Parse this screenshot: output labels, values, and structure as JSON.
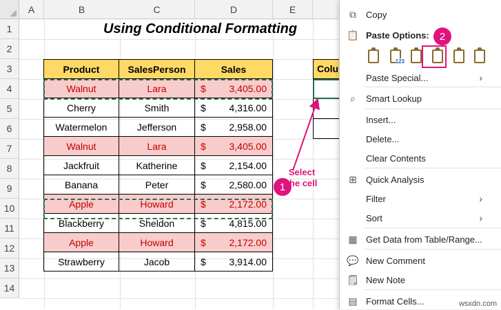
{
  "columns": [
    "A",
    "B",
    "C",
    "D",
    "E"
  ],
  "rows": [
    "1",
    "2",
    "3",
    "4",
    "5",
    "6",
    "7",
    "8",
    "9",
    "10",
    "11",
    "12",
    "13",
    "14"
  ],
  "title": "Using Conditional Formatting",
  "table": {
    "headers": [
      "Product",
      "SalesPerson",
      "Sales"
    ],
    "currency": "$",
    "rows": [
      {
        "product": "Walnut",
        "person": "Lara",
        "sales": "3,405.00",
        "highlight": true
      },
      {
        "product": "Cherry",
        "person": "Smith",
        "sales": "4,316.00",
        "highlight": false
      },
      {
        "product": "Watermelon",
        "person": "Jefferson",
        "sales": "2,958.00",
        "highlight": false
      },
      {
        "product": "Walnut",
        "person": "Lara",
        "sales": "3,405.00",
        "highlight": true
      },
      {
        "product": "Jackfruit",
        "person": "Katherine",
        "sales": "2,154.00",
        "highlight": false
      },
      {
        "product": "Banana",
        "person": "Peter",
        "sales": "2,580.00",
        "highlight": false
      },
      {
        "product": "Apple",
        "person": "Howard",
        "sales": "2,172.00",
        "highlight": true
      },
      {
        "product": "Blackberry",
        "person": "Sheldon",
        "sales": "4,815.00",
        "highlight": false
      },
      {
        "product": "Apple",
        "person": "Howard",
        "sales": "2,172.00",
        "highlight": true
      },
      {
        "product": "Strawberry",
        "person": "Jacob",
        "sales": "3,914.00",
        "highlight": false
      }
    ]
  },
  "side_table": {
    "header": "Colu"
  },
  "annotations": {
    "badge1": "1",
    "badge2": "2",
    "note": "Select the cell"
  },
  "menu": {
    "copy": "Copy",
    "paste_options": "Paste Options:",
    "paste_sub_123": "123",
    "paste_special": "Paste Special...",
    "smart_lookup": "Smart Lookup",
    "insert": "Insert...",
    "delete": "Delete...",
    "clear_contents": "Clear Contents",
    "quick_analysis": "Quick Analysis",
    "filter": "Filter",
    "sort": "Sort",
    "get_data": "Get Data from Table/Range...",
    "new_comment": "New Comment",
    "new_note": "New Note",
    "format_cells": "Format Cells..."
  },
  "watermark": "wsxdn.com",
  "colors": {
    "header_fill": "#ffd966",
    "highlight_fill": "#f9cccc",
    "highlight_text": "#c00000",
    "annotation": "#e0137e"
  }
}
